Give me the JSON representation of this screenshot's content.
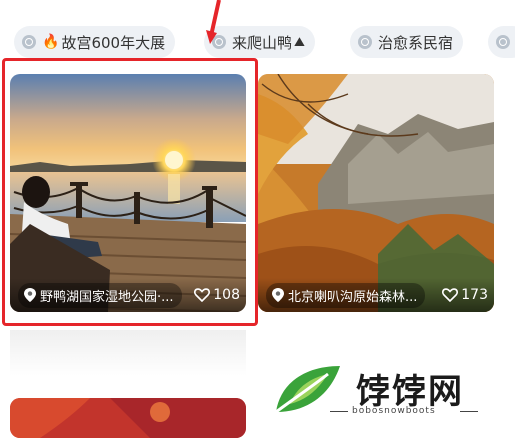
{
  "tags": [
    {
      "label": "故宫600年大展",
      "emoji": "🔥"
    },
    {
      "label": "来爬山鸭",
      "emoji_after": "⛰"
    },
    {
      "label": "治愈系民宿"
    }
  ],
  "cards": [
    {
      "location": "野鸭湖国家湿地公园·...",
      "likes": "108"
    },
    {
      "location": "北京喇叭沟原始森林...",
      "likes": "173"
    }
  ],
  "watermark": {
    "title": "饽饽网",
    "subtitle": "bobosnowboots"
  },
  "colors": {
    "highlight": "#e5252a",
    "tag_bg": "#eef1f5",
    "logo_green": "#3aa33a"
  }
}
